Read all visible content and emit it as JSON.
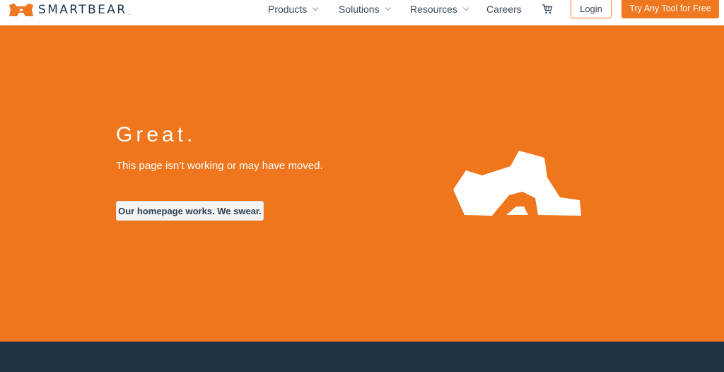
{
  "header": {
    "brand": "SMARTBEAR",
    "brand_mark": ".",
    "nav": [
      {
        "label": "Products"
      },
      {
        "label": "Solutions"
      },
      {
        "label": "Resources"
      },
      {
        "label": "Careers"
      }
    ],
    "cart_icon": "cart-icon",
    "login_label": "Login",
    "cta_label": "Try Any Tool for Free"
  },
  "hero": {
    "title": "Great.",
    "subtitle": "This page isn’t working or may have moved.",
    "button_label": "Our homepage works. We swear.",
    "illustration": "broken-bear-icon"
  },
  "colors": {
    "accent": "#ef761d",
    "navy": "#1f3447",
    "text": "#3b4a5a"
  }
}
